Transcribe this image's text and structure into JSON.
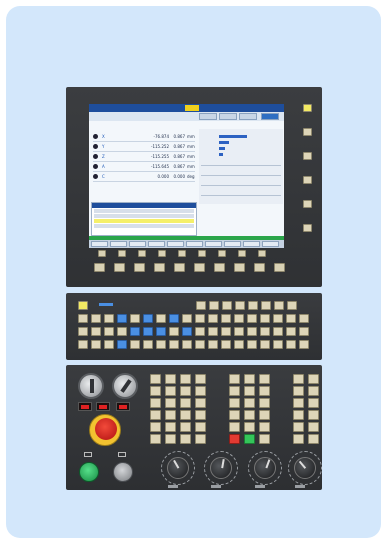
{
  "screen": {
    "axis_rows": [
      {
        "name": "X",
        "value": "-76.874",
        "value2": "0.867",
        "unit": "mm"
      },
      {
        "name": "Y",
        "value": "-115.252",
        "value2": "0.867",
        "unit": "mm"
      },
      {
        "name": "Z",
        "value": "-115.255",
        "value2": "0.867",
        "unit": "mm"
      },
      {
        "name": "A",
        "value": "-115.645",
        "value2": "0.867",
        "unit": "mm"
      },
      {
        "name": "C",
        "value": "0.000",
        "value2": "0.000",
        "unit": "deg"
      }
    ]
  },
  "colors": {
    "panel": "#333538",
    "key_beige": "#ddd5b8",
    "key_blue": "#4a8fe3",
    "key_yellow": "#f3ea63",
    "screen_blue": "#1e4e9c",
    "status_green": "#2aa54a",
    "estop_red": "#d8201a",
    "card_bg": "#d3e7fb"
  }
}
